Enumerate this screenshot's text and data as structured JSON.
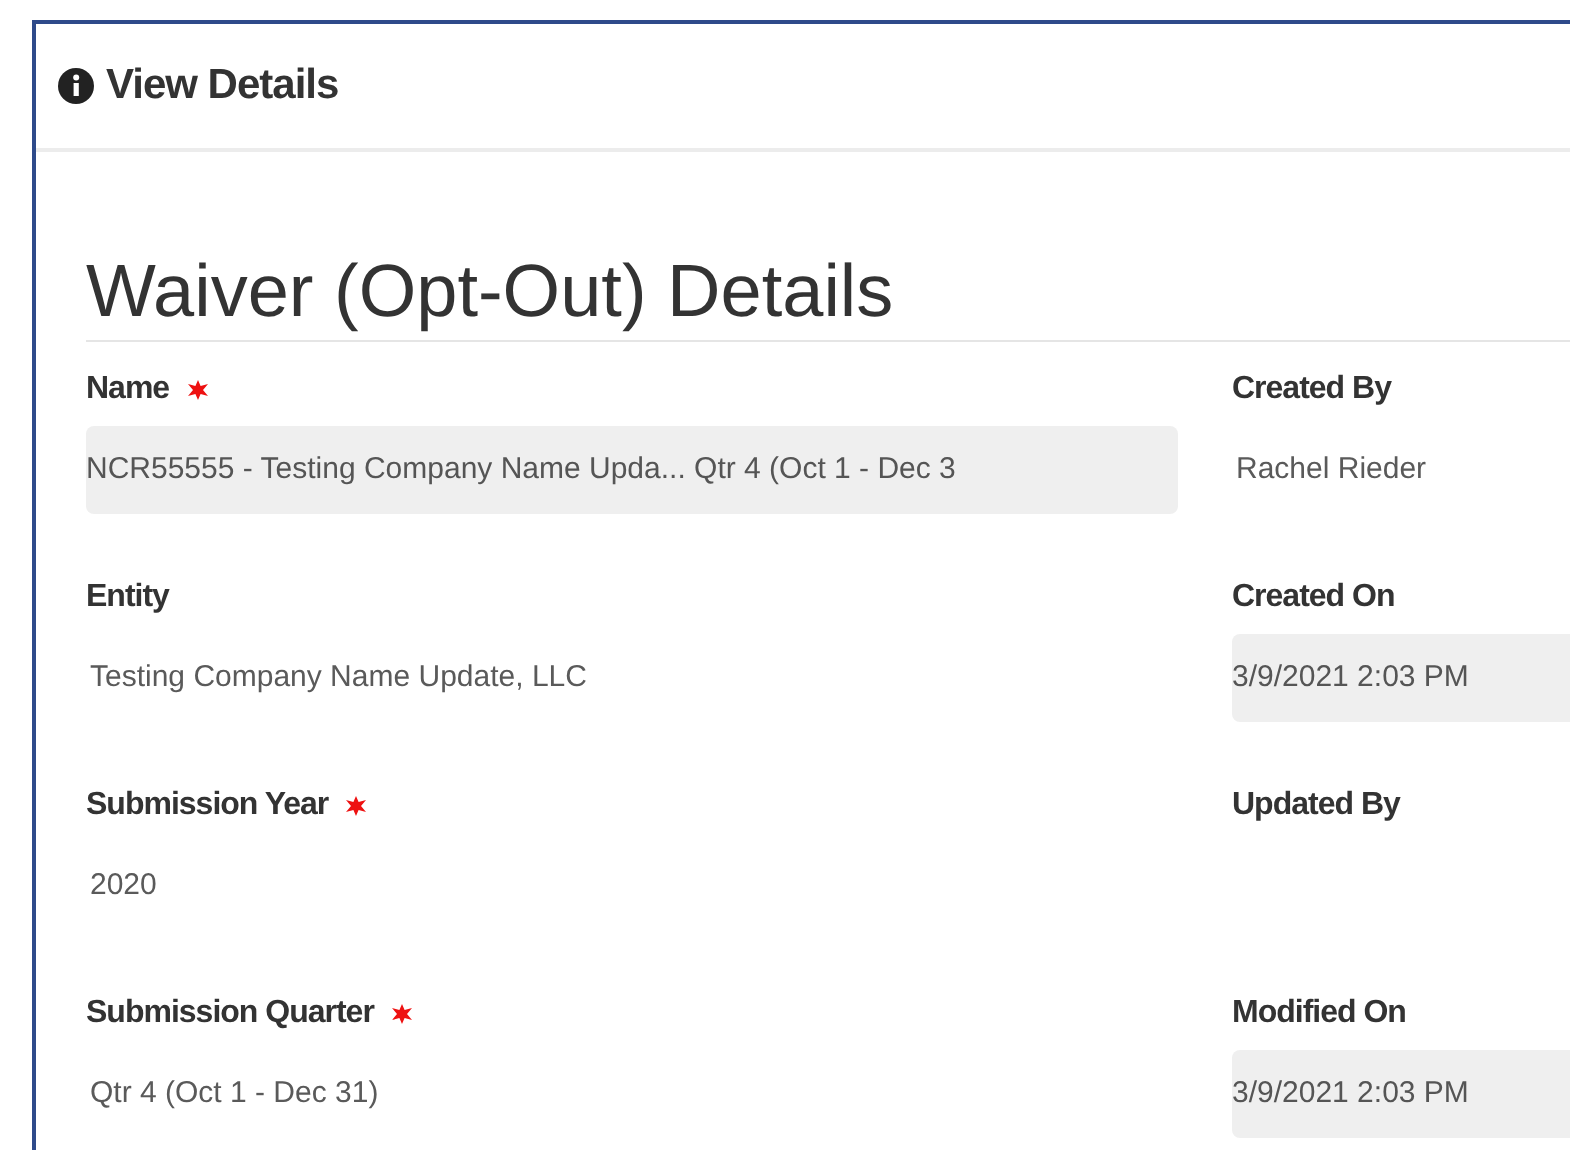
{
  "panel": {
    "title": "View Details"
  },
  "form": {
    "heading": "Waiver (Opt-Out) Details",
    "rows": [
      {
        "left": {
          "label": "Name",
          "required": true,
          "value": "NCR55555 - Testing Company Name Upda... Qtr 4 (Oct 1 - Dec 3",
          "shaded": true
        },
        "right": {
          "label": "Created By",
          "value": "Rachel Rieder",
          "shaded": false
        }
      },
      {
        "left": {
          "label": "Entity",
          "value": "Testing Company Name Update, LLC",
          "shaded": false
        },
        "right": {
          "label": "Created On",
          "value": "3/9/2021 2:03 PM",
          "shaded": true
        }
      },
      {
        "left": {
          "label": "Submission Year",
          "required": true,
          "value": "2020",
          "shaded": false
        },
        "right": {
          "label": "Updated By"
        }
      },
      {
        "left": {
          "label": "Submission Quarter",
          "required": true,
          "value": "Qtr 4 (Oct 1 - Dec 31)",
          "shaded": false
        },
        "right": {
          "label": "Modified On",
          "value": "3/9/2021 2:03 PM",
          "shaded": true
        }
      }
    ]
  }
}
